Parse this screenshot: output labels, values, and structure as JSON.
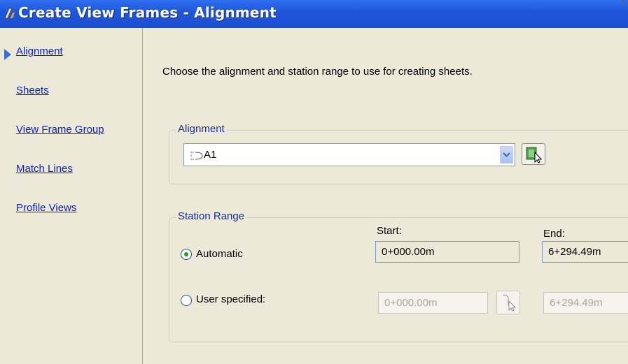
{
  "window": {
    "title": "Create View Frames - Alignment"
  },
  "sidebar": {
    "items": [
      {
        "label": "Alignment",
        "active": true
      },
      {
        "label": "Sheets"
      },
      {
        "label": "View Frame Group"
      },
      {
        "label": "Match Lines"
      },
      {
        "label": "Profile Views"
      }
    ]
  },
  "main": {
    "instruction": "Choose the alignment and station range to use for creating sheets.",
    "alignment_group": {
      "label": "Alignment",
      "selected": "A1"
    },
    "station_range": {
      "label": "Station Range",
      "start_label": "Start:",
      "end_label": "End:",
      "options": [
        {
          "label": "Automatic",
          "selected": true,
          "start": "0+000.00m",
          "end": "6+294.49m"
        },
        {
          "label": "User specified:",
          "selected": false,
          "start": "0+000.00m",
          "end": "6+294.49m"
        }
      ]
    }
  },
  "icons": {
    "title": "app-icon",
    "combo": "alignment-icon",
    "dropdown": "chevron-down-icon",
    "pick": "pick-from-drawing-icon",
    "pick_station": "pick-station-icon"
  },
  "colors": {
    "titlebar": "#1f55d8",
    "link": "#0a1fb0",
    "dialog": "#ece9d8",
    "radio_dot": "#21a121"
  }
}
